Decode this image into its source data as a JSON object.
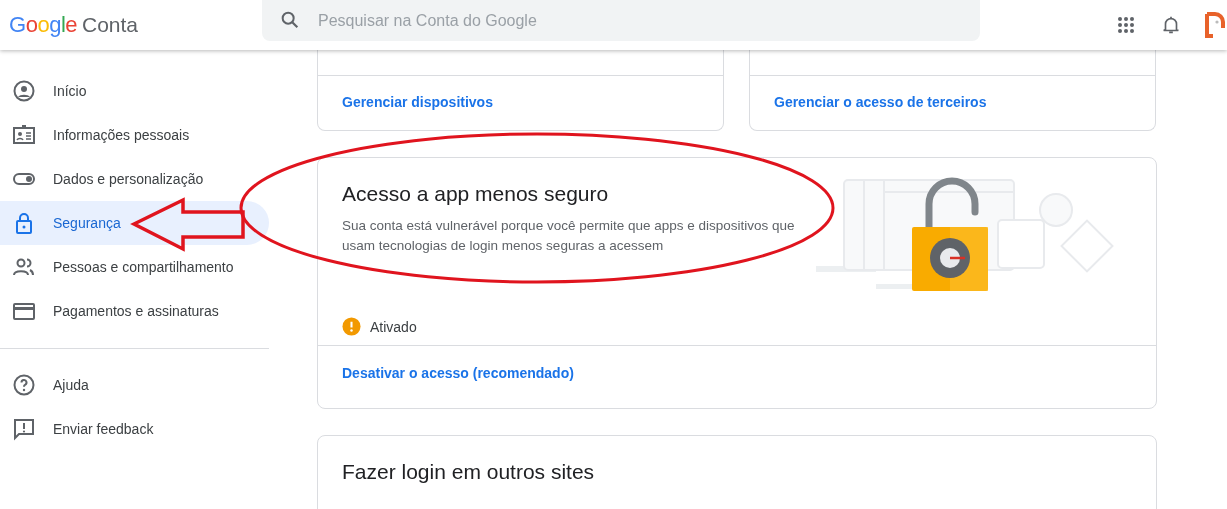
{
  "header": {
    "logo_word": "Google",
    "product": "Conta",
    "search": {
      "placeholder": "Pesquisar na Conta do Google"
    }
  },
  "sidebar": {
    "items": [
      {
        "label": "Início",
        "selected": false
      },
      {
        "label": "Informações pessoais",
        "selected": false
      },
      {
        "label": "Dados e personalização",
        "selected": false
      },
      {
        "label": "Segurança",
        "selected": true
      },
      {
        "label": "Pessoas e compartilhamento",
        "selected": false
      },
      {
        "label": "Pagamentos e assinaturas",
        "selected": false
      }
    ],
    "footer_items": [
      {
        "label": "Ajuda"
      },
      {
        "label": "Enviar feedback"
      }
    ]
  },
  "top_cards": [
    {
      "link": "Gerenciar dispositivos"
    },
    {
      "link": "Gerenciar o acesso de terceiros"
    }
  ],
  "less_secure_card": {
    "title": "Acesso a app menos seguro",
    "description": "Sua conta está vulnerável porque você permite que apps e dispositivos que usam tecnologias de login menos seguras a acessem",
    "status": "Ativado",
    "warning": true,
    "link": "Desativar o acesso (recomendado)"
  },
  "other_sites_card": {
    "title": "Fazer login em outros sites"
  }
}
